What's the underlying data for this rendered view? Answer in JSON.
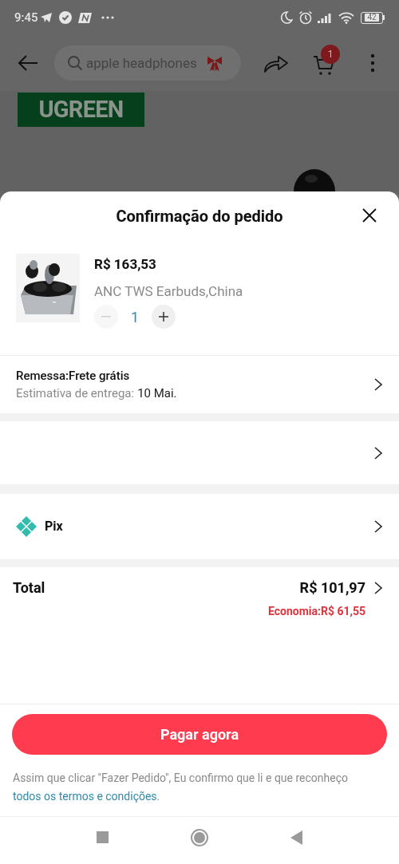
{
  "status_bar": {
    "time": "9:45",
    "battery": "42"
  },
  "app_bar": {
    "search": {
      "placeholder": "apple headphones"
    },
    "cart_badge": "1"
  },
  "brand_banner": {
    "text": "UGREEN"
  },
  "sheet": {
    "title": "Confirmação do pedido",
    "product": {
      "price": "R$ 163,53",
      "name": "ANC TWS Earbuds,China",
      "quantity": "1",
      "decrease_disabled": true
    },
    "shipping": {
      "label": "Remessa:Frete grátis",
      "estimate_label": "Estimativa de entrega:",
      "estimate_value": "10 Mai."
    },
    "payment": {
      "method": "Pix"
    },
    "total": {
      "label": "Total",
      "value": "R$ 101,97",
      "savings": "Economia:R$ 61,55"
    },
    "pay_button": "Pagar agora",
    "terms": {
      "text": "Assim que clicar \"Fazer Pedido\", Eu confirmo que li e que reconheço",
      "link": "todos os termos e condições",
      "end": "."
    }
  }
}
